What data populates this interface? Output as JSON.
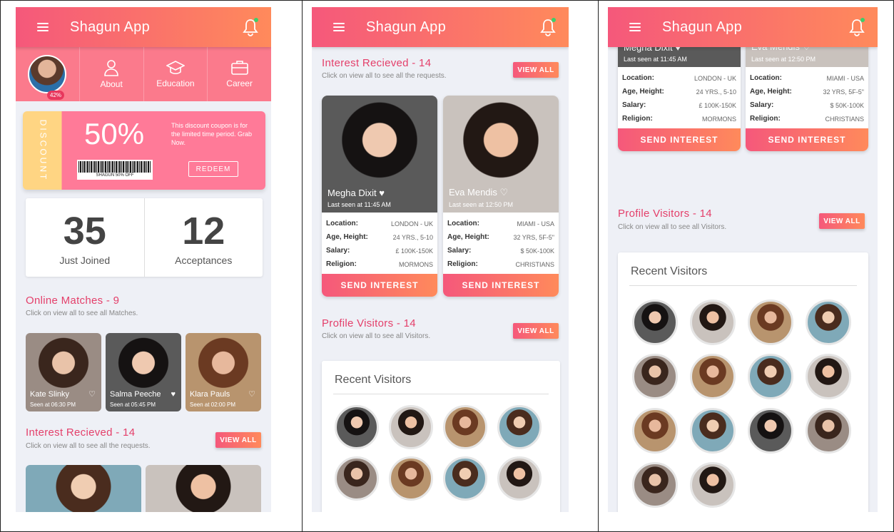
{
  "app": {
    "title": "Shagun App"
  },
  "profile_bar": {
    "completion": "42%",
    "items": [
      {
        "label": "About",
        "icon": "person-icon"
      },
      {
        "label": "Education",
        "icon": "graduation-cap-icon"
      },
      {
        "label": "Career",
        "icon": "briefcase-icon"
      }
    ]
  },
  "coupon": {
    "side_label": "DISCOUNT",
    "percent": "50%",
    "description": "This discount coupon is for the limited time period. Grab Now.",
    "barcode_label": "SHAGUN 50% OFF",
    "redeem": "REDEEM"
  },
  "stats": [
    {
      "value": "35",
      "label": "Just Joined"
    },
    {
      "value": "12",
      "label": "Acceptances"
    }
  ],
  "online_matches": {
    "title": "Online Matches - 9",
    "subtitle": "Click on view all to see all Matches.",
    "cards": [
      {
        "name": "Kate Slinky",
        "seen": "Seen at 06:30 PM"
      },
      {
        "name": "Salma Peeche",
        "seen": "Seen at 05:45 PM"
      },
      {
        "name": "Klara Pauls",
        "seen": "Seen at 02:00 PM"
      }
    ]
  },
  "interest": {
    "title": "Interest Recieved - 14",
    "subtitle": "Click on view all to see all the requests.",
    "view_all": "VIEW ALL"
  },
  "profiles": [
    {
      "name": "Megha Dixit",
      "last_seen": "Last seen at 11:45 AM",
      "location": "LONDON - UK",
      "age_height": "24 YRS., 5-10",
      "salary": "£ 100K-150K",
      "religion": "MORMONS"
    },
    {
      "name": "Eva Mendis",
      "last_seen": "Last seen at 12:50 PM",
      "location": "MIAMI - USA",
      "age_height": "32 YRS, 5F-5\"",
      "salary": "$ 50K-100K",
      "religion": "CHRISTIANS"
    }
  ],
  "field_labels": {
    "location": "Location:",
    "age_height": "Age, Height:",
    "salary": "Salary:",
    "religion": "Religion:"
  },
  "send_interest": "SEND INTEREST",
  "visitors": {
    "title": "Profile Visitors - 14",
    "subtitle": "Click on view all to see all Visitors.",
    "view_all": "VIEW ALL",
    "box_title": "Recent Visitors"
  },
  "colors": {
    "primary": "#f5587b",
    "secondary": "#ff8a5b",
    "heading": "#e43f6a"
  }
}
